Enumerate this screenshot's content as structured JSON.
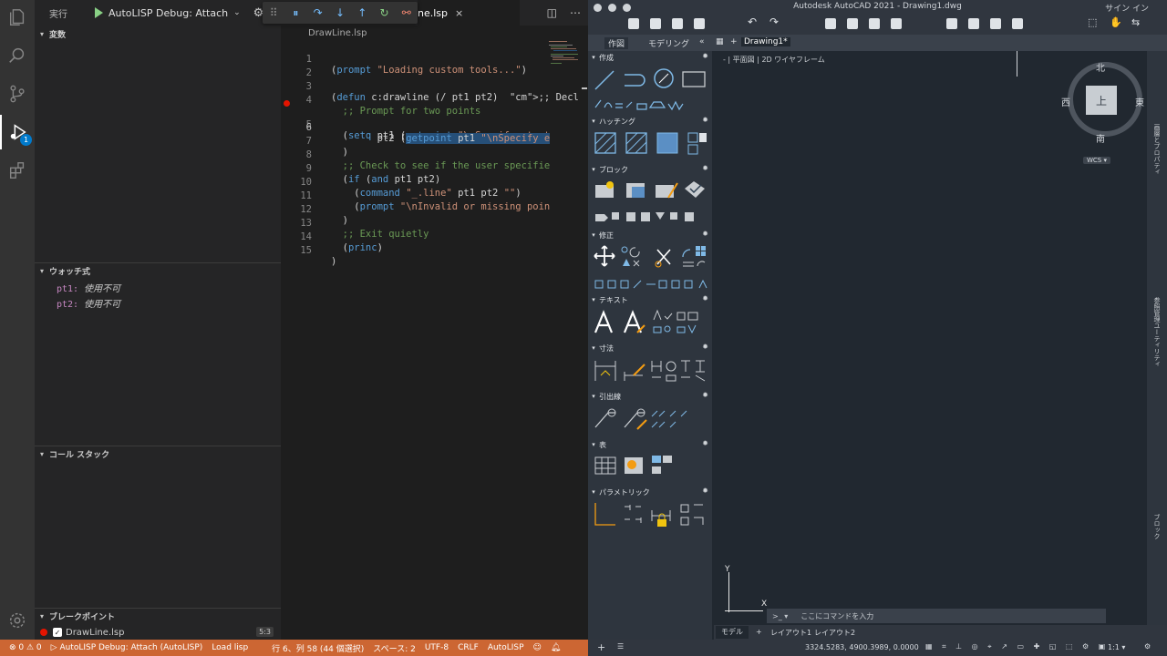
{
  "vscode": {
    "sidebar": {
      "run_label": "実行",
      "config_name": "AutoLISP Debug: Attach",
      "sections": {
        "variables": "変数",
        "watch": "ウォッチ式",
        "callstack": "コール スタック",
        "breakpoints": "ブレークポイント"
      },
      "watch_items": [
        {
          "name": "pt1:",
          "value": "使用不可"
        },
        {
          "name": "pt2:",
          "value": "使用不可"
        }
      ],
      "breakpoint": {
        "file": "DrawLine.lsp",
        "position": "5:3"
      }
    },
    "activity_badge": "1",
    "tab": {
      "label": "ne.lsp",
      "close": "×"
    },
    "breadcrumb": "DrawLine.lsp",
    "code_lines": [
      {
        "n": "1",
        "t": "(prompt \"Loading custom tools...\")"
      },
      {
        "n": "2",
        "t": ""
      },
      {
        "n": "3",
        "t": "(defun c:drawline (/ pt1 pt2)  ;; Decl"
      },
      {
        "n": "4",
        "t": "  ;; Prompt for two points"
      },
      {
        "n": "5",
        "t": "  (setq pt1 (getpoint \"\\nSpecify start"
      },
      {
        "n": "6",
        "t": "        pt2 (getpoint pt1 \"\\nSpecify e"
      },
      {
        "n": "7",
        "t": "  )"
      },
      {
        "n": "8",
        "t": "  ;; Check to see if the user specifie"
      },
      {
        "n": "9",
        "t": "  (if (and pt1 pt2)"
      },
      {
        "n": "10",
        "t": "    (command \"_.line\" pt1 pt2 \"\")"
      },
      {
        "n": "11",
        "t": "    (prompt \"\\nInvalid or missing poin"
      },
      {
        "n": "12",
        "t": "  )"
      },
      {
        "n": "13",
        "t": "  ;; Exit quietly"
      },
      {
        "n": "14",
        "t": "  (princ)"
      },
      {
        "n": "15",
        "t": ")"
      }
    ],
    "statusbar": {
      "problems": "⊗ 0 ⚠ 0",
      "debug_config": "▷ AutoLISP Debug: Attach (AutoLISP)",
      "load": "Load lisp",
      "cursor": "行 6、列 58 (44 個選択)",
      "spaces": "スペース: 2",
      "encoding": "UTF-8",
      "eol": "CRLF",
      "language": "AutoLISP"
    },
    "colors": {
      "statusbar": "#cc6633",
      "accent": "#007acc",
      "breakpoint": "#e51400"
    }
  },
  "autocad": {
    "title": "Autodesk AutoCAD 2021 - Drawing1.dwg",
    "signin": "サイン イン",
    "tabs": [
      "作図",
      "モデリング"
    ],
    "drawing_tab": "Drawing1*",
    "viewport_label": "- | 平面図 | 2D ワイヤフレーム",
    "palette_sections": [
      "作成",
      "ハッチング",
      "ブロック",
      "修正",
      "テキスト",
      "寸法",
      "引出線",
      "表",
      "パラメトリック"
    ],
    "viewcube": {
      "top": "上",
      "north": "北",
      "south": "南",
      "east": "東",
      "west": "西",
      "wcs": "WCS ▾"
    },
    "ucs": {
      "x": "X",
      "y": "Y"
    },
    "command_prompt": ">_ ▾",
    "command_placeholder": "ここにコマンドを入力",
    "layout_tabs": [
      "モデル",
      "レイアウト1",
      "レイアウト2"
    ],
    "coords": "3324.5283, 4900.3989, 0.0000",
    "scale": "1:1 ▾",
    "right_rail": [
      "画層とプロパティ",
      "参照管理ユーティリティ",
      "ブロック"
    ]
  }
}
